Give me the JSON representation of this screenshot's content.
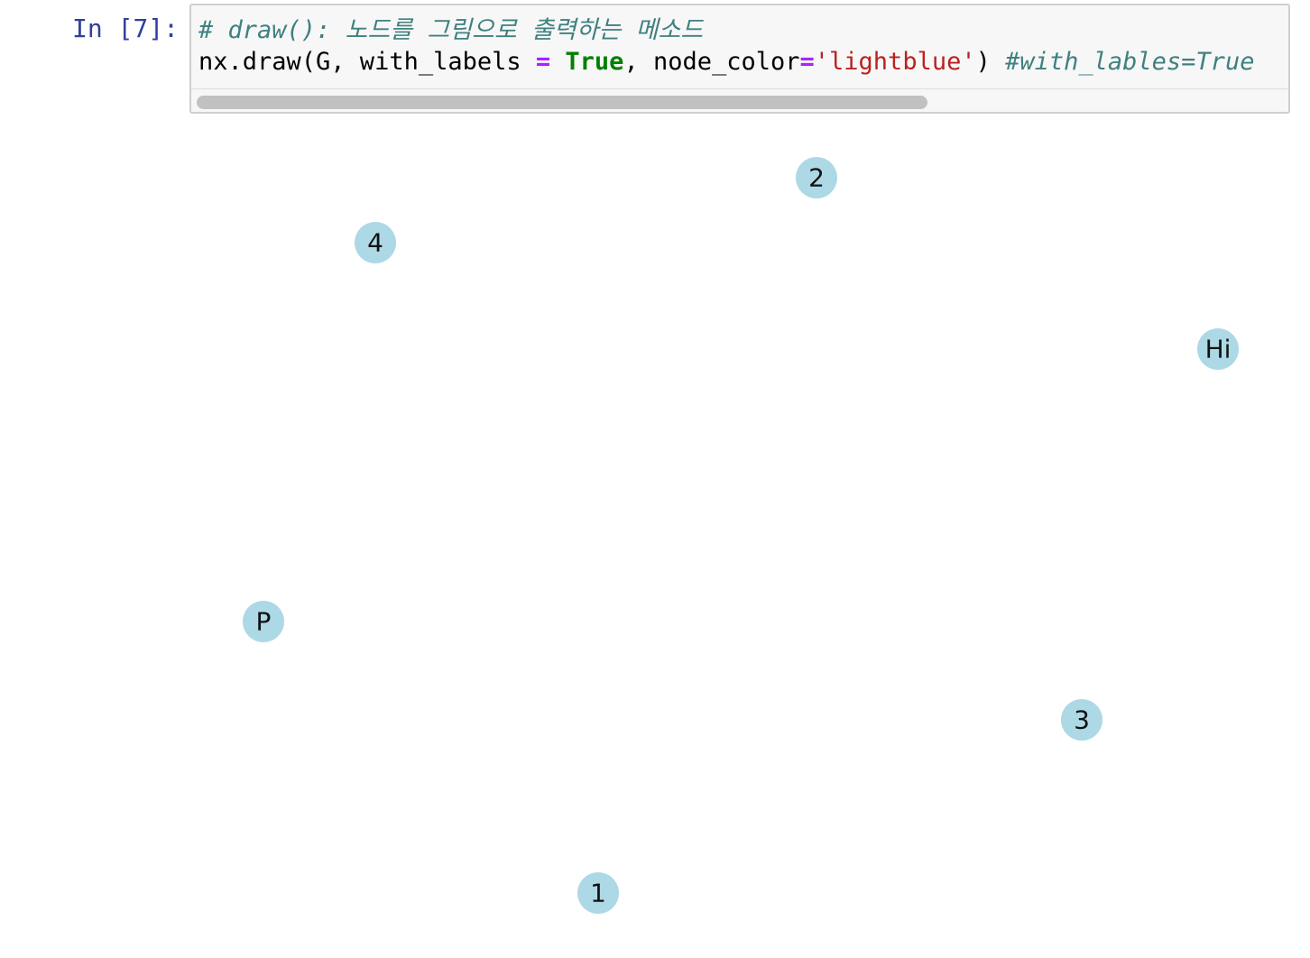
{
  "cell": {
    "prompt": "In [7]:",
    "code": {
      "comment_line": "# draw(): 노드를 그림으로 출력하는 메소드",
      "line2_parts": {
        "p1": "nx.draw(G, with_labels ",
        "op1": "=",
        "p2": " ",
        "kw": "True",
        "p3": ", node_color",
        "op2": "=",
        "str": "'lightblue'",
        "p4": ") ",
        "comment": "#with_lables=True"
      }
    }
  },
  "output": {
    "node_color": "#add8e6",
    "nodes": [
      {
        "label": "2"
      },
      {
        "label": "4"
      },
      {
        "label": "Hi"
      },
      {
        "label": "P"
      },
      {
        "label": "3"
      },
      {
        "label": "1"
      }
    ]
  }
}
